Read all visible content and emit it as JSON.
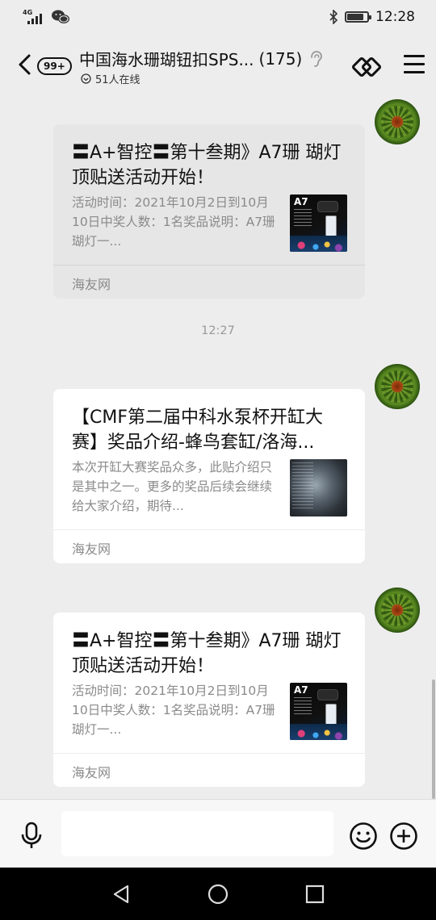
{
  "status_bar": {
    "network_type": "4G",
    "signal_icon": "signal-icon",
    "wechat_icon": "wechat-icon",
    "bluetooth_icon": "bluetooth-icon",
    "battery_level": 0.85,
    "time": "12:28"
  },
  "header": {
    "back_icon": "chevron-left-icon",
    "unread_count": "99+",
    "title": "中国海水珊瑚钮扣SPS...",
    "member_count": "(175)",
    "ear_icon": "ear-icon",
    "online_status": "51人在线",
    "switch_icon": "switch-icon",
    "menu_icon": "menu-icon"
  },
  "messages": [
    {
      "type": "link_card",
      "title": "〓A+智控〓第十叁期》A7珊 瑚灯顶贴送活动开始！",
      "description": "活动时间：2021年10月2日到10月10日中奖人数：1名奖品说明：A7珊瑚灯一...",
      "thumbnail_label": "A7",
      "source": "海友网",
      "selected": true
    },
    {
      "type": "timestamp",
      "text": "12:27"
    },
    {
      "type": "link_card",
      "title": "【CMF第二届中科水泵杯开缸大赛】奖品介绍-蜂鸟套缸/洛海...",
      "description": "本次开缸大赛奖品众多，此贴介绍只是其中之一。更多的奖品后续会继续给大家介绍，期待...",
      "thumbnail_label": "",
      "source": "海友网",
      "selected": false
    },
    {
      "type": "link_card",
      "title": "〓A+智控〓第十叁期》A7珊 瑚灯顶贴送活动开始！",
      "description": "活动时间：2021年10月2日到10月10日中奖人数：1名奖品说明：A7珊瑚灯一...",
      "thumbnail_label": "A7",
      "source": "海友网",
      "selected": false
    }
  ],
  "input_bar": {
    "voice_icon": "microphone-icon",
    "input_value": "",
    "emoji_icon": "emoji-icon",
    "plus_icon": "plus-circle-icon"
  },
  "nav_bar": {
    "back_icon": "triangle-back-icon",
    "home_icon": "circle-home-icon",
    "recents_icon": "square-recents-icon"
  }
}
